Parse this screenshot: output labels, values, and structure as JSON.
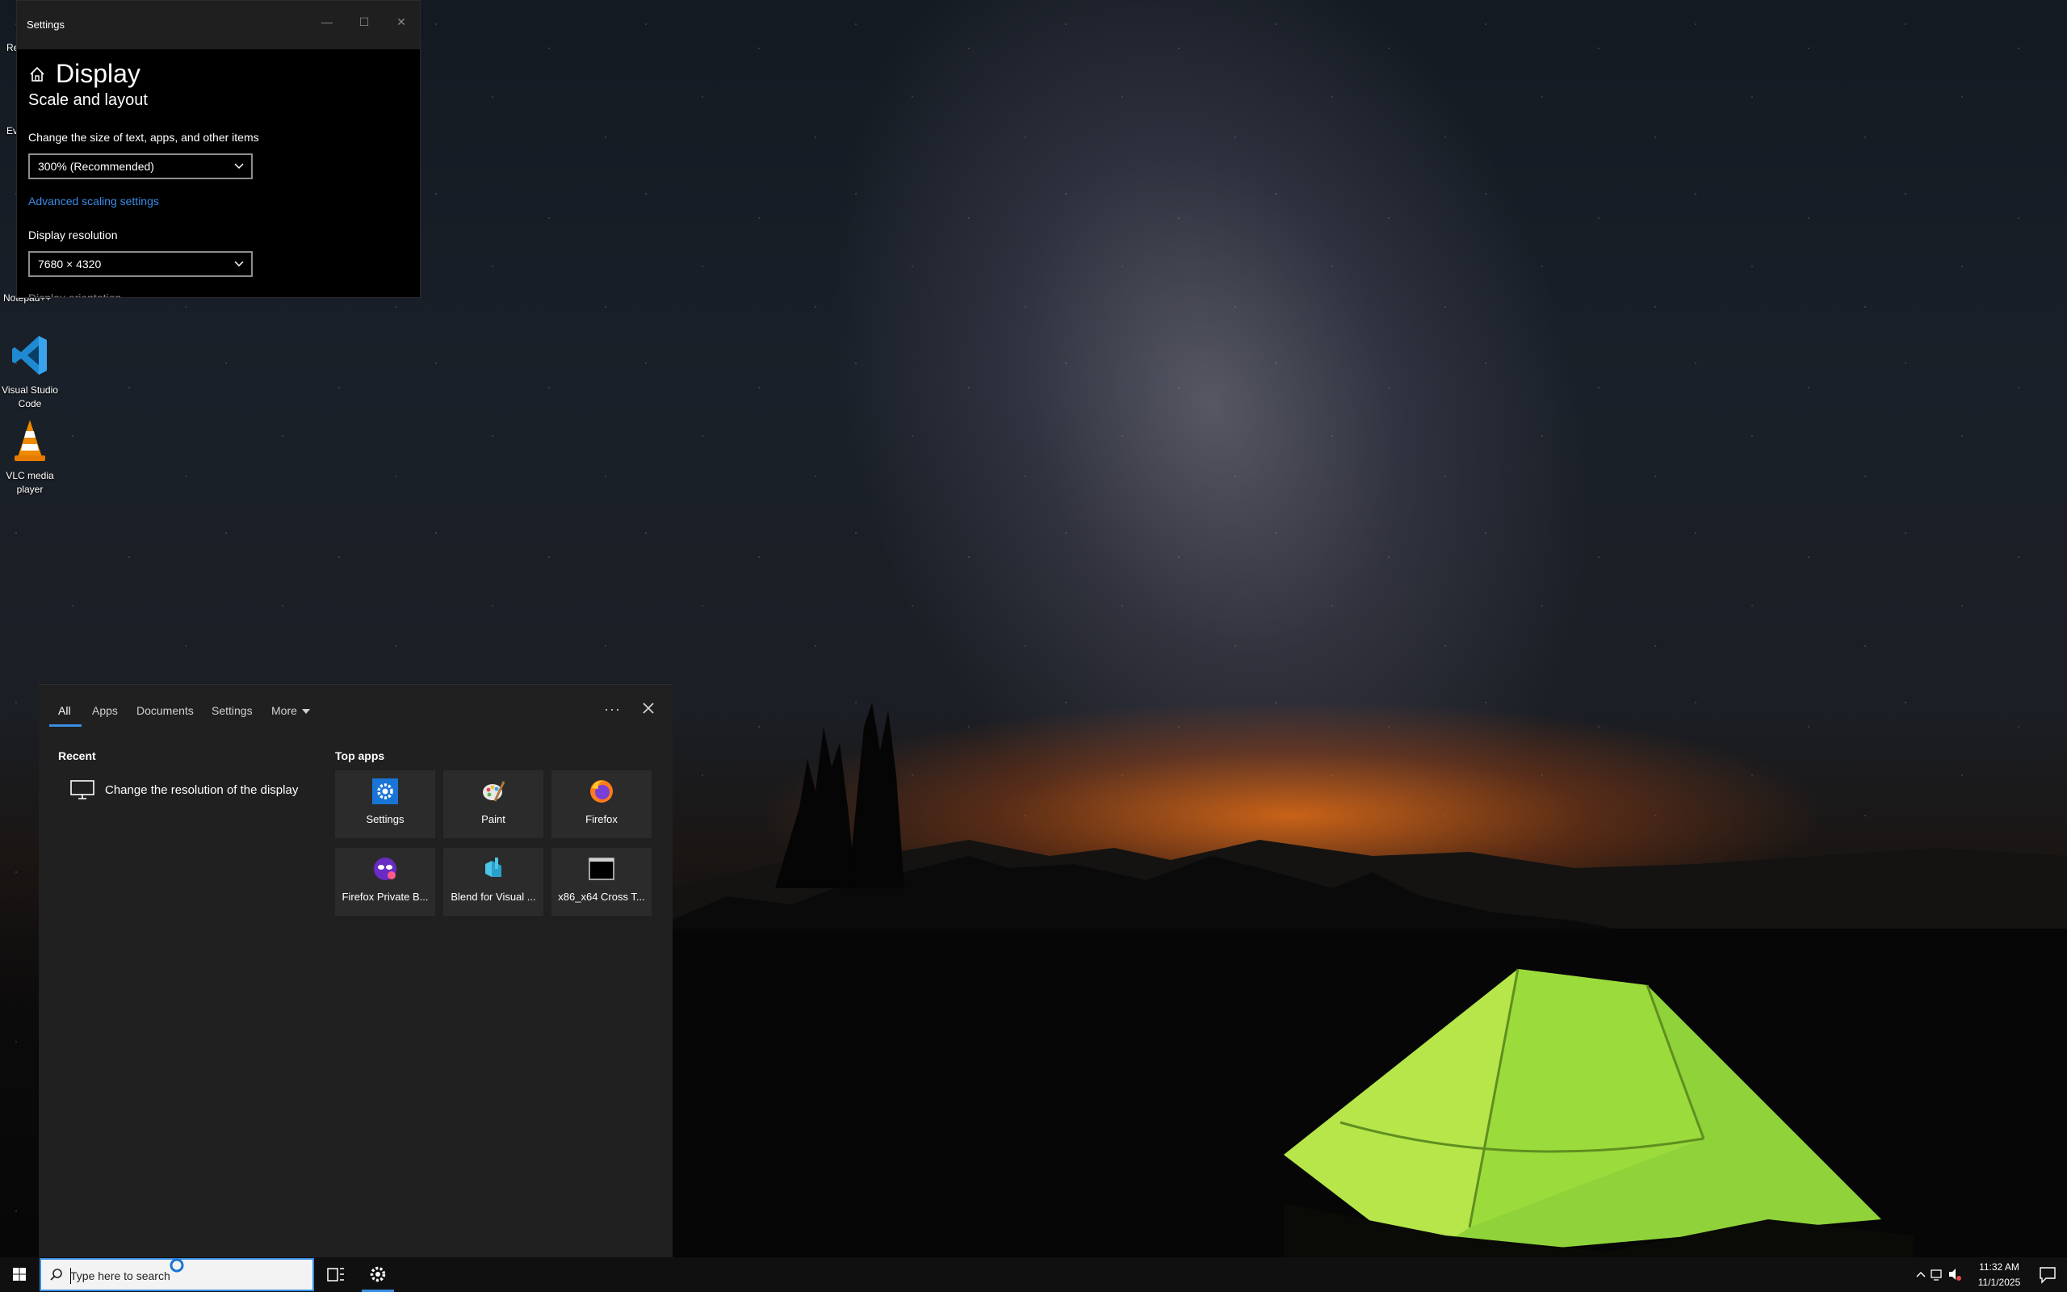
{
  "desktop": {
    "icons": [
      {
        "label": "Visual Studio Code"
      },
      {
        "label": "VLC media player"
      }
    ],
    "partial_labels": [
      "Re",
      "Ev",
      "Notepad++"
    ]
  },
  "settings_window": {
    "title": "Settings",
    "controls": {
      "minimize": "—",
      "maximize": "☐",
      "close": "✕"
    },
    "page_title": "Display",
    "section_title": "Scale and layout",
    "scale_label": "Change the size of text, apps, and other items",
    "scale_value": "300% (Recommended)",
    "advanced_link": "Advanced scaling settings",
    "resolution_label": "Display resolution",
    "resolution_value": "7680 × 4320",
    "orientation_label_partial": "Display orientation"
  },
  "search_panel": {
    "tabs": [
      "All",
      "Apps",
      "Documents",
      "Settings",
      "More"
    ],
    "active_tab": "All",
    "more_options": "···",
    "recent_heading": "Recent",
    "recent_items": [
      {
        "label": "Change the resolution of the display",
        "icon": "monitor-icon"
      }
    ],
    "top_apps_heading": "Top apps",
    "top_apps": [
      {
        "label": "Settings",
        "icon": "settings-gear-icon"
      },
      {
        "label": "Paint",
        "icon": "paint-icon"
      },
      {
        "label": "Firefox",
        "icon": "firefox-icon"
      },
      {
        "label": "Firefox Private B...",
        "icon": "firefox-private-icon"
      },
      {
        "label": "Blend for Visual ...",
        "icon": "blend-icon"
      },
      {
        "label": "x86_x64 Cross T...",
        "icon": "terminal-icon"
      }
    ]
  },
  "taskbar": {
    "search_placeholder": "Type here to search",
    "time": "11:32 AM",
    "date": "11/1/2025"
  },
  "colors": {
    "accent": "#3a8ee6",
    "link": "#3d8be8",
    "panel_bg": "#202020",
    "tile_bg": "#2b2b2b",
    "taskbar_bg": "#101010"
  }
}
